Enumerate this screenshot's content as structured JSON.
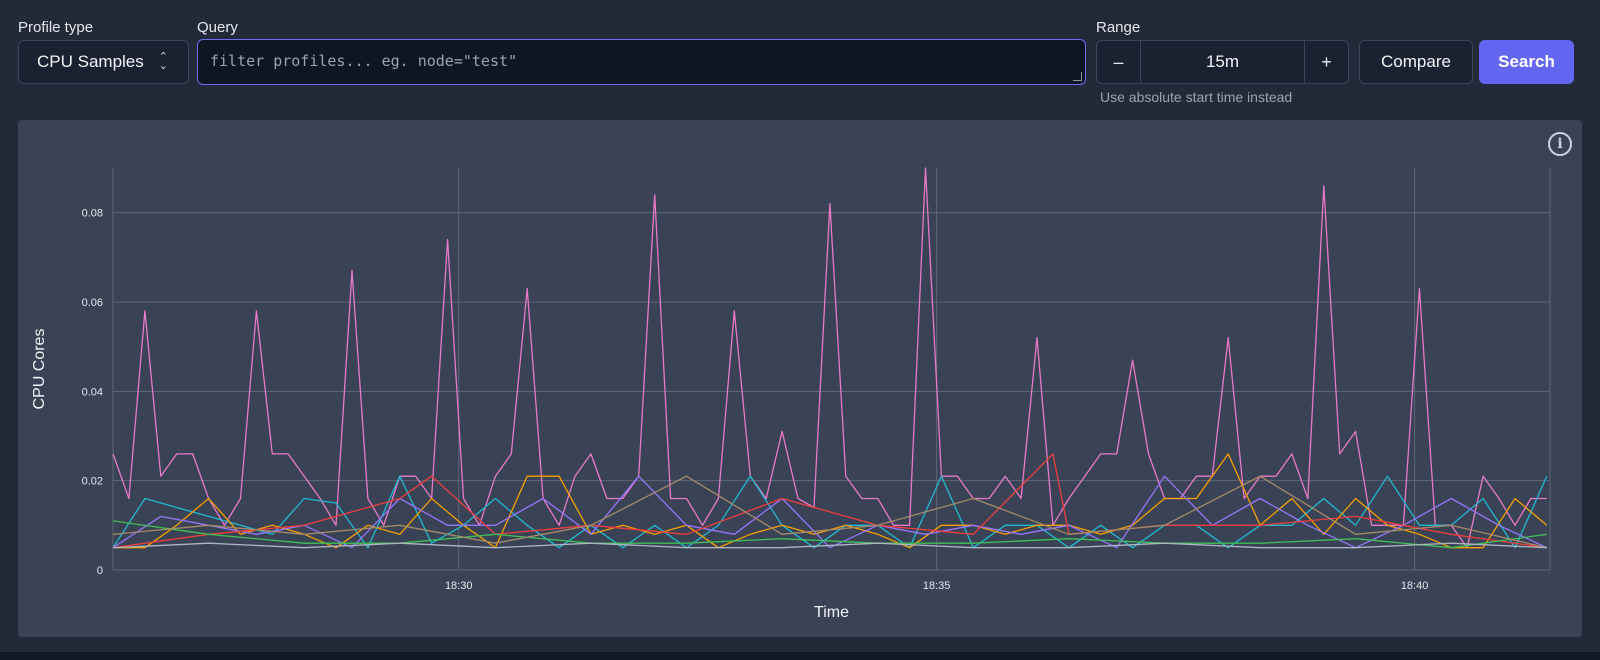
{
  "controls": {
    "profile_type_label": "Profile type",
    "profile_type_value": "CPU Samples",
    "query_label": "Query",
    "query_placeholder": "filter profiles... eg. node=\"test\"",
    "query_value": "",
    "range_label": "Range",
    "range_minus": "–",
    "range_value": "15m",
    "range_plus": "+",
    "absolute_time_link": "Use absolute start time instead",
    "compare_label": "Compare",
    "search_label": "Search",
    "info_glyph": "i",
    "colors": {
      "accent": "#6366f1",
      "panel": "#394355",
      "background": "#222a3a"
    }
  },
  "chart_data": {
    "type": "line",
    "xlabel": "Time",
    "ylabel": "CPU Cores",
    "ylim": [
      0,
      0.09
    ],
    "yticks": [
      0,
      0.02,
      0.04,
      0.06,
      0.08
    ],
    "ytick_labels": [
      "0",
      "0.02",
      "0.04",
      "0.06",
      "0.08"
    ],
    "xticks": [
      "18:30",
      "18:35",
      "18:40"
    ],
    "xlim": [
      "18:26:23",
      "18:41:25"
    ],
    "grid": true,
    "legend": "none",
    "series": [
      {
        "color": "#e879c9",
        "x": [
          "18:26:23",
          "18:26:33",
          "18:26:43",
          "18:26:53",
          "18:27:03",
          "18:27:13",
          "18:27:23",
          "18:27:33",
          "18:27:43",
          "18:27:53",
          "18:28:03",
          "18:28:13",
          "18:28:23",
          "18:28:33",
          "18:28:43",
          "18:28:53",
          "18:29:03",
          "18:29:13",
          "18:29:23",
          "18:29:33",
          "18:29:43",
          "18:29:53",
          "18:30:03",
          "18:30:13",
          "18:30:23",
          "18:30:33",
          "18:30:43",
          "18:30:53",
          "18:31:03",
          "18:31:13",
          "18:31:23",
          "18:31:33",
          "18:31:43",
          "18:31:53",
          "18:32:03",
          "18:32:13",
          "18:32:23",
          "18:32:33",
          "18:32:43",
          "18:32:53",
          "18:33:03",
          "18:33:13",
          "18:33:23",
          "18:33:33",
          "18:33:43",
          "18:33:53",
          "18:34:03",
          "18:34:13",
          "18:34:23",
          "18:34:33",
          "18:34:43",
          "18:34:53",
          "18:35:03",
          "18:35:13",
          "18:35:23",
          "18:35:33",
          "18:35:43",
          "18:35:53",
          "18:36:03",
          "18:36:13",
          "18:36:23",
          "18:36:33",
          "18:36:43",
          "18:36:53",
          "18:37:03",
          "18:37:13",
          "18:37:23",
          "18:37:33",
          "18:37:43",
          "18:37:53",
          "18:38:03",
          "18:38:13",
          "18:38:23",
          "18:38:33",
          "18:38:43",
          "18:38:53",
          "18:39:03",
          "18:39:13",
          "18:39:23",
          "18:39:33",
          "18:39:43",
          "18:39:53",
          "18:40:03",
          "18:40:13",
          "18:40:23",
          "18:40:33",
          "18:40:43",
          "18:40:53",
          "18:41:03",
          "18:41:13",
          "18:41:23"
        ],
        "values": [
          0.026,
          0.016,
          0.058,
          0.021,
          0.026,
          0.026,
          0.016,
          0.01,
          0.016,
          0.058,
          0.026,
          0.026,
          0.021,
          0.016,
          0.01,
          0.067,
          0.016,
          0.01,
          0.021,
          0.021,
          0.016,
          0.074,
          0.016,
          0.01,
          0.021,
          0.026,
          0.063,
          0.016,
          0.01,
          0.021,
          0.026,
          0.016,
          0.016,
          0.021,
          0.084,
          0.016,
          0.016,
          0.01,
          0.016,
          0.058,
          0.021,
          0.016,
          0.031,
          0.016,
          0.014,
          0.082,
          0.021,
          0.016,
          0.016,
          0.01,
          0.01,
          0.09,
          0.021,
          0.021,
          0.016,
          0.016,
          0.021,
          0.016,
          0.052,
          0.01,
          0.016,
          0.021,
          0.026,
          0.026,
          0.047,
          0.026,
          0.016,
          0.016,
          0.021,
          0.021,
          0.052,
          0.016,
          0.021,
          0.021,
          0.026,
          0.016,
          0.086,
          0.026,
          0.031,
          0.01,
          0.01,
          0.01,
          0.063,
          0.01,
          0.01,
          0.005,
          0.021,
          0.016,
          0.01,
          0.016,
          0.016
        ]
      },
      {
        "color": "#22b8cf",
        "x": [
          "18:26:23",
          "18:26:43",
          "18:27:03",
          "18:27:23",
          "18:27:43",
          "18:28:03",
          "18:28:23",
          "18:28:43",
          "18:29:03",
          "18:29:23",
          "18:29:43",
          "18:30:03",
          "18:30:23",
          "18:30:43",
          "18:31:03",
          "18:31:23",
          "18:31:43",
          "18:32:03",
          "18:32:23",
          "18:32:43",
          "18:33:03",
          "18:33:23",
          "18:33:43",
          "18:34:03",
          "18:34:23",
          "18:34:43",
          "18:35:03",
          "18:35:23",
          "18:35:43",
          "18:36:03",
          "18:36:23",
          "18:36:43",
          "18:37:03",
          "18:37:23",
          "18:37:43",
          "18:38:03",
          "18:38:23",
          "18:38:43",
          "18:39:03",
          "18:39:23",
          "18:39:43",
          "18:40:03",
          "18:40:23",
          "18:40:43",
          "18:41:03",
          "18:41:23"
        ],
        "values": [
          0.005,
          0.016,
          0.014,
          0.012,
          0.01,
          0.008,
          0.016,
          0.015,
          0.005,
          0.021,
          0.006,
          0.01,
          0.016,
          0.01,
          0.005,
          0.01,
          0.005,
          0.01,
          0.005,
          0.01,
          0.021,
          0.01,
          0.005,
          0.01,
          0.01,
          0.005,
          0.021,
          0.005,
          0.01,
          0.01,
          0.005,
          0.01,
          0.005,
          0.01,
          0.01,
          0.005,
          0.01,
          0.01,
          0.016,
          0.01,
          0.021,
          0.01,
          0.01,
          0.016,
          0.005,
          0.021
        ]
      },
      {
        "color": "#f59f00",
        "x": [
          "18:26:23",
          "18:26:43",
          "18:27:03",
          "18:27:23",
          "18:27:43",
          "18:28:03",
          "18:28:23",
          "18:28:43",
          "18:29:03",
          "18:29:23",
          "18:29:43",
          "18:30:03",
          "18:30:23",
          "18:30:43",
          "18:31:03",
          "18:31:23",
          "18:31:43",
          "18:32:03",
          "18:32:23",
          "18:32:43",
          "18:33:03",
          "18:33:23",
          "18:33:43",
          "18:34:03",
          "18:34:23",
          "18:34:43",
          "18:35:03",
          "18:35:23",
          "18:35:43",
          "18:36:03",
          "18:36:23",
          "18:36:43",
          "18:37:03",
          "18:37:23",
          "18:37:43",
          "18:38:03",
          "18:38:23",
          "18:38:43",
          "18:39:03",
          "18:39:23",
          "18:39:43",
          "18:40:03",
          "18:40:23",
          "18:40:43",
          "18:41:03",
          "18:41:23"
        ],
        "values": [
          0.005,
          0.005,
          0.01,
          0.016,
          0.008,
          0.01,
          0.008,
          0.005,
          0.01,
          0.008,
          0.016,
          0.01,
          0.005,
          0.021,
          0.021,
          0.008,
          0.01,
          0.008,
          0.01,
          0.005,
          0.008,
          0.01,
          0.008,
          0.01,
          0.008,
          0.005,
          0.01,
          0.01,
          0.008,
          0.01,
          0.01,
          0.008,
          0.01,
          0.016,
          0.016,
          0.026,
          0.01,
          0.016,
          0.008,
          0.016,
          0.01,
          0.008,
          0.005,
          0.005,
          0.016,
          0.01
        ]
      },
      {
        "color": "#9775fa",
        "x": [
          "18:26:23",
          "18:26:53",
          "18:27:23",
          "18:27:53",
          "18:28:23",
          "18:28:53",
          "18:29:23",
          "18:29:53",
          "18:30:23",
          "18:30:53",
          "18:31:23",
          "18:31:53",
          "18:32:23",
          "18:32:53",
          "18:33:23",
          "18:33:53",
          "18:34:23",
          "18:34:53",
          "18:35:23",
          "18:35:53",
          "18:36:23",
          "18:36:53",
          "18:37:23",
          "18:37:53",
          "18:38:23",
          "18:38:53",
          "18:39:23",
          "18:39:53",
          "18:40:23",
          "18:40:53",
          "18:41:23"
        ],
        "values": [
          0.005,
          0.012,
          0.01,
          0.008,
          0.01,
          0.005,
          0.016,
          0.01,
          0.01,
          0.016,
          0.008,
          0.021,
          0.01,
          0.008,
          0.016,
          0.005,
          0.01,
          0.008,
          0.01,
          0.008,
          0.01,
          0.005,
          0.021,
          0.01,
          0.016,
          0.01,
          0.005,
          0.01,
          0.016,
          0.01,
          0.005
        ]
      },
      {
        "color": "#f03e3e",
        "x": [
          "18:26:23",
          "18:27:23",
          "18:28:23",
          "18:29:23",
          "18:29:43",
          "18:30:23",
          "18:31:23",
          "18:32:23",
          "18:33:23",
          "18:34:23",
          "18:35:23",
          "18:36:13",
          "18:36:23",
          "18:37:23",
          "18:38:23",
          "18:39:23",
          "18:40:23",
          "18:41:23"
        ],
        "values": [
          0.005,
          0.008,
          0.01,
          0.016,
          0.021,
          0.008,
          0.01,
          0.008,
          0.016,
          0.01,
          0.008,
          0.026,
          0.008,
          0.01,
          0.01,
          0.012,
          0.008,
          0.005
        ]
      },
      {
        "color": "#40c057",
        "x": [
          "18:26:23",
          "18:27:23",
          "18:28:23",
          "18:29:23",
          "18:30:23",
          "18:31:23",
          "18:32:23",
          "18:33:23",
          "18:34:23",
          "18:35:23",
          "18:36:23",
          "18:37:23",
          "18:38:23",
          "18:39:23",
          "18:40:23",
          "18:41:23"
        ],
        "values": [
          0.011,
          0.008,
          0.006,
          0.006,
          0.008,
          0.006,
          0.006,
          0.007,
          0.006,
          0.006,
          0.007,
          0.006,
          0.006,
          0.007,
          0.005,
          0.008
        ]
      },
      {
        "color": "#a58a6a",
        "x": [
          "18:26:23",
          "18:27:23",
          "18:28:23",
          "18:29:23",
          "18:30:23",
          "18:31:23",
          "18:32:23",
          "18:33:23",
          "18:34:23",
          "18:35:23",
          "18:36:23",
          "18:37:23",
          "18:38:23",
          "18:39:23",
          "18:40:23",
          "18:41:23"
        ],
        "values": [
          0.008,
          0.01,
          0.008,
          0.01,
          0.006,
          0.01,
          0.021,
          0.008,
          0.01,
          0.016,
          0.008,
          0.01,
          0.021,
          0.008,
          0.01,
          0.005
        ]
      },
      {
        "color": "#adb5bd",
        "x": [
          "18:26:23",
          "18:27:23",
          "18:28:23",
          "18:29:23",
          "18:30:23",
          "18:31:23",
          "18:32:23",
          "18:33:23",
          "18:34:23",
          "18:35:23",
          "18:36:23",
          "18:37:23",
          "18:38:23",
          "18:39:23",
          "18:40:23",
          "18:41:23"
        ],
        "values": [
          0.005,
          0.006,
          0.005,
          0.006,
          0.005,
          0.006,
          0.005,
          0.005,
          0.006,
          0.005,
          0.005,
          0.006,
          0.005,
          0.005,
          0.006,
          0.005
        ]
      }
    ]
  }
}
